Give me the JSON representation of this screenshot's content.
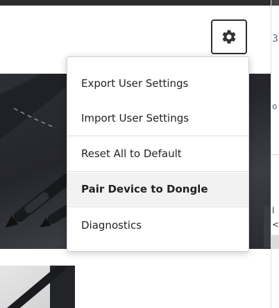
{
  "settings_menu": {
    "items": [
      {
        "label": "Export User Settings",
        "bold": false
      },
      {
        "label": "Import User Settings",
        "bold": false
      },
      {
        "label": "Reset All to Default",
        "bold": false
      },
      {
        "label": "Pair Device to Dongle",
        "bold": true
      },
      {
        "label": "Diagnostics",
        "bold": false
      }
    ]
  },
  "right_strip": {
    "fragments": [
      "3",
      "o",
      "l",
      "<"
    ]
  },
  "icons": {
    "settings": "gear-icon"
  },
  "colors": {
    "topbar": "#2b2b2b",
    "hero_background": "#2d2f36",
    "menu_background": "#ffffff",
    "menu_hover": "#f2f2f2",
    "text": "#222222"
  }
}
